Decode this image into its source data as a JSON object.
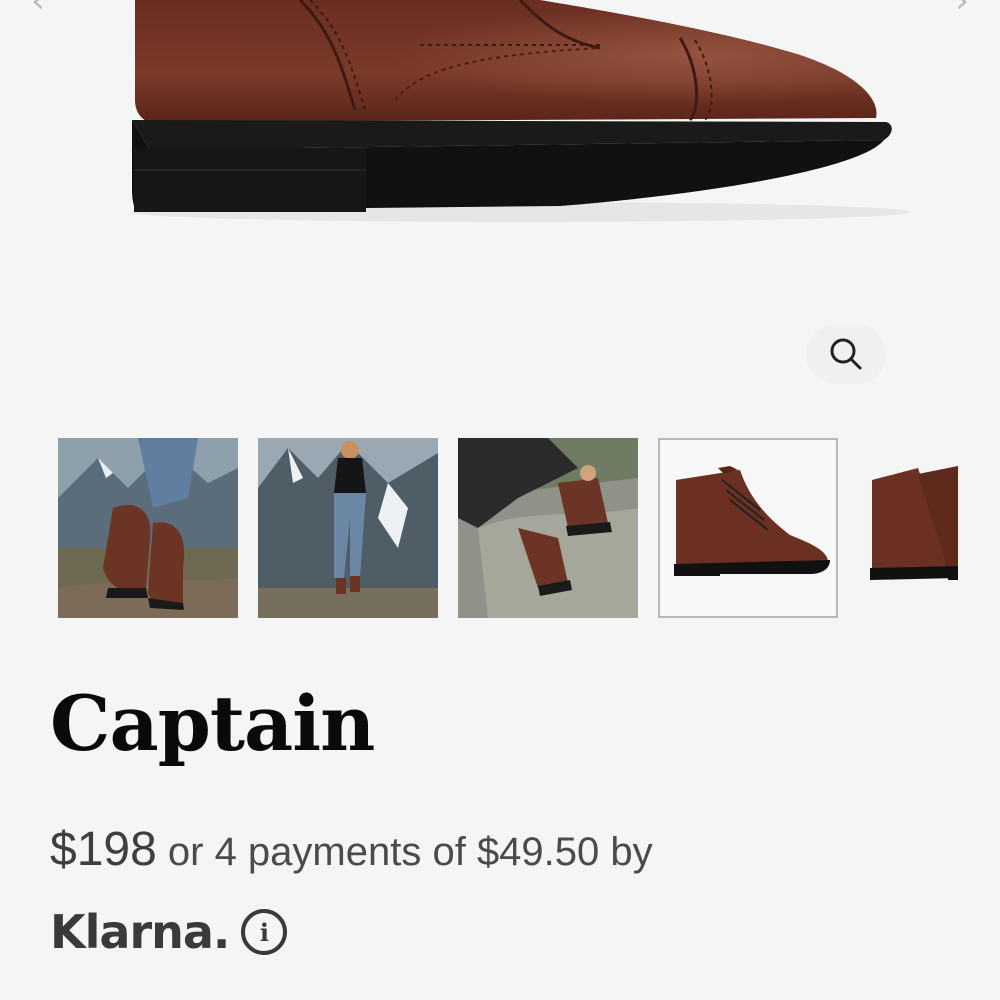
{
  "gallery": {
    "prev_icon": "chevron-left-icon",
    "next_icon": "chevron-right-icon",
    "zoom_icon": "magnifier-icon",
    "selected_index": 3,
    "thumbnails": [
      {
        "subject": "boots-on-mountain-trail"
      },
      {
        "subject": "woman-standing-in-mountains"
      },
      {
        "subject": "person-tying-boots-on-rock"
      },
      {
        "subject": "boot-product-side-view"
      },
      {
        "subject": "boot-pair-product-view"
      }
    ]
  },
  "product": {
    "name": "Captain",
    "price": "$198",
    "installment_text": " or 4 payments of $49.50 by",
    "payment_provider": "Klarna.",
    "info_symbol": "i"
  },
  "colors": {
    "background": "#f5f5f5",
    "leather": "#6e3325",
    "sole": "#111111",
    "text_primary": "#0a0a0a",
    "text_secondary": "#4b4b4b"
  }
}
